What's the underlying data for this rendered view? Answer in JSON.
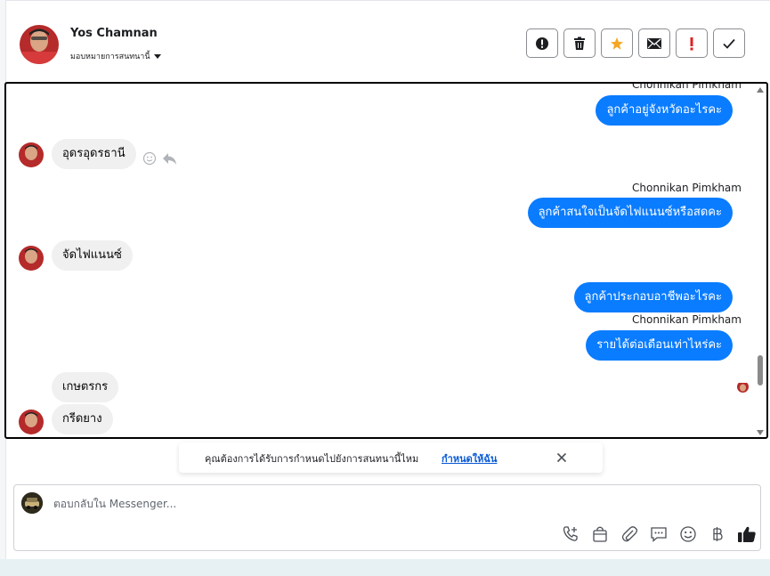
{
  "header": {
    "contact_name": "Yos Chamnan",
    "assign_label": "มอบหมายการสนทนานี้",
    "actions": [
      {
        "icon": "alert-circle-icon",
        "label": "spam"
      },
      {
        "icon": "trash-icon",
        "label": "delete"
      },
      {
        "icon": "star-icon",
        "label": "star"
      },
      {
        "icon": "envelope-icon",
        "label": "unread"
      },
      {
        "icon": "exclamation-icon",
        "label": "follow-up"
      },
      {
        "icon": "check-icon",
        "label": "done"
      }
    ]
  },
  "conversation": {
    "messages": [
      {
        "direction": "out",
        "sender": "Chonnikan Pimkham",
        "text": "ลูกค้าอยู่จังหวัดอะไรคะ"
      },
      {
        "direction": "in",
        "text": "อุดรอุดรธานี"
      },
      {
        "direction": "out",
        "sender": "Chonnikan Pimkham",
        "text": "ลูกค้าสนใจเป็นจัดไฟแนนซ์หรือสดคะ"
      },
      {
        "direction": "in",
        "text": "จัดไฟแนนซ์"
      },
      {
        "direction": "out",
        "text": "ลูกค้าประกอบอาชีพอะไรคะ"
      },
      {
        "direction": "out",
        "sender": "Chonnikan Pimkham",
        "text": "รายได้ต่อเดือนเท่าไหร่คะ"
      },
      {
        "direction": "in",
        "text": "เกษตรกร"
      },
      {
        "direction": "in",
        "text": "กรีดยาง"
      }
    ]
  },
  "notice": {
    "text": "คุณต้องการได้รับการกำหนดไปยังการสนทนานี้ไหม",
    "link": "กำหนดให้ฉัน"
  },
  "composer": {
    "placeholder": "ตอบกลับใน Messenger...",
    "tools": [
      "phone-plus-icon",
      "shopping-bag-icon",
      "paperclip-icon",
      "saved-reply-icon",
      "emoji-icon",
      "baht-icon",
      "thumbs-up-icon"
    ]
  },
  "colors": {
    "outgoing_bubble": "#0a7cff",
    "incoming_bubble": "#f0f0f0",
    "star": "#f5a623",
    "exclamation": "#e02020"
  }
}
